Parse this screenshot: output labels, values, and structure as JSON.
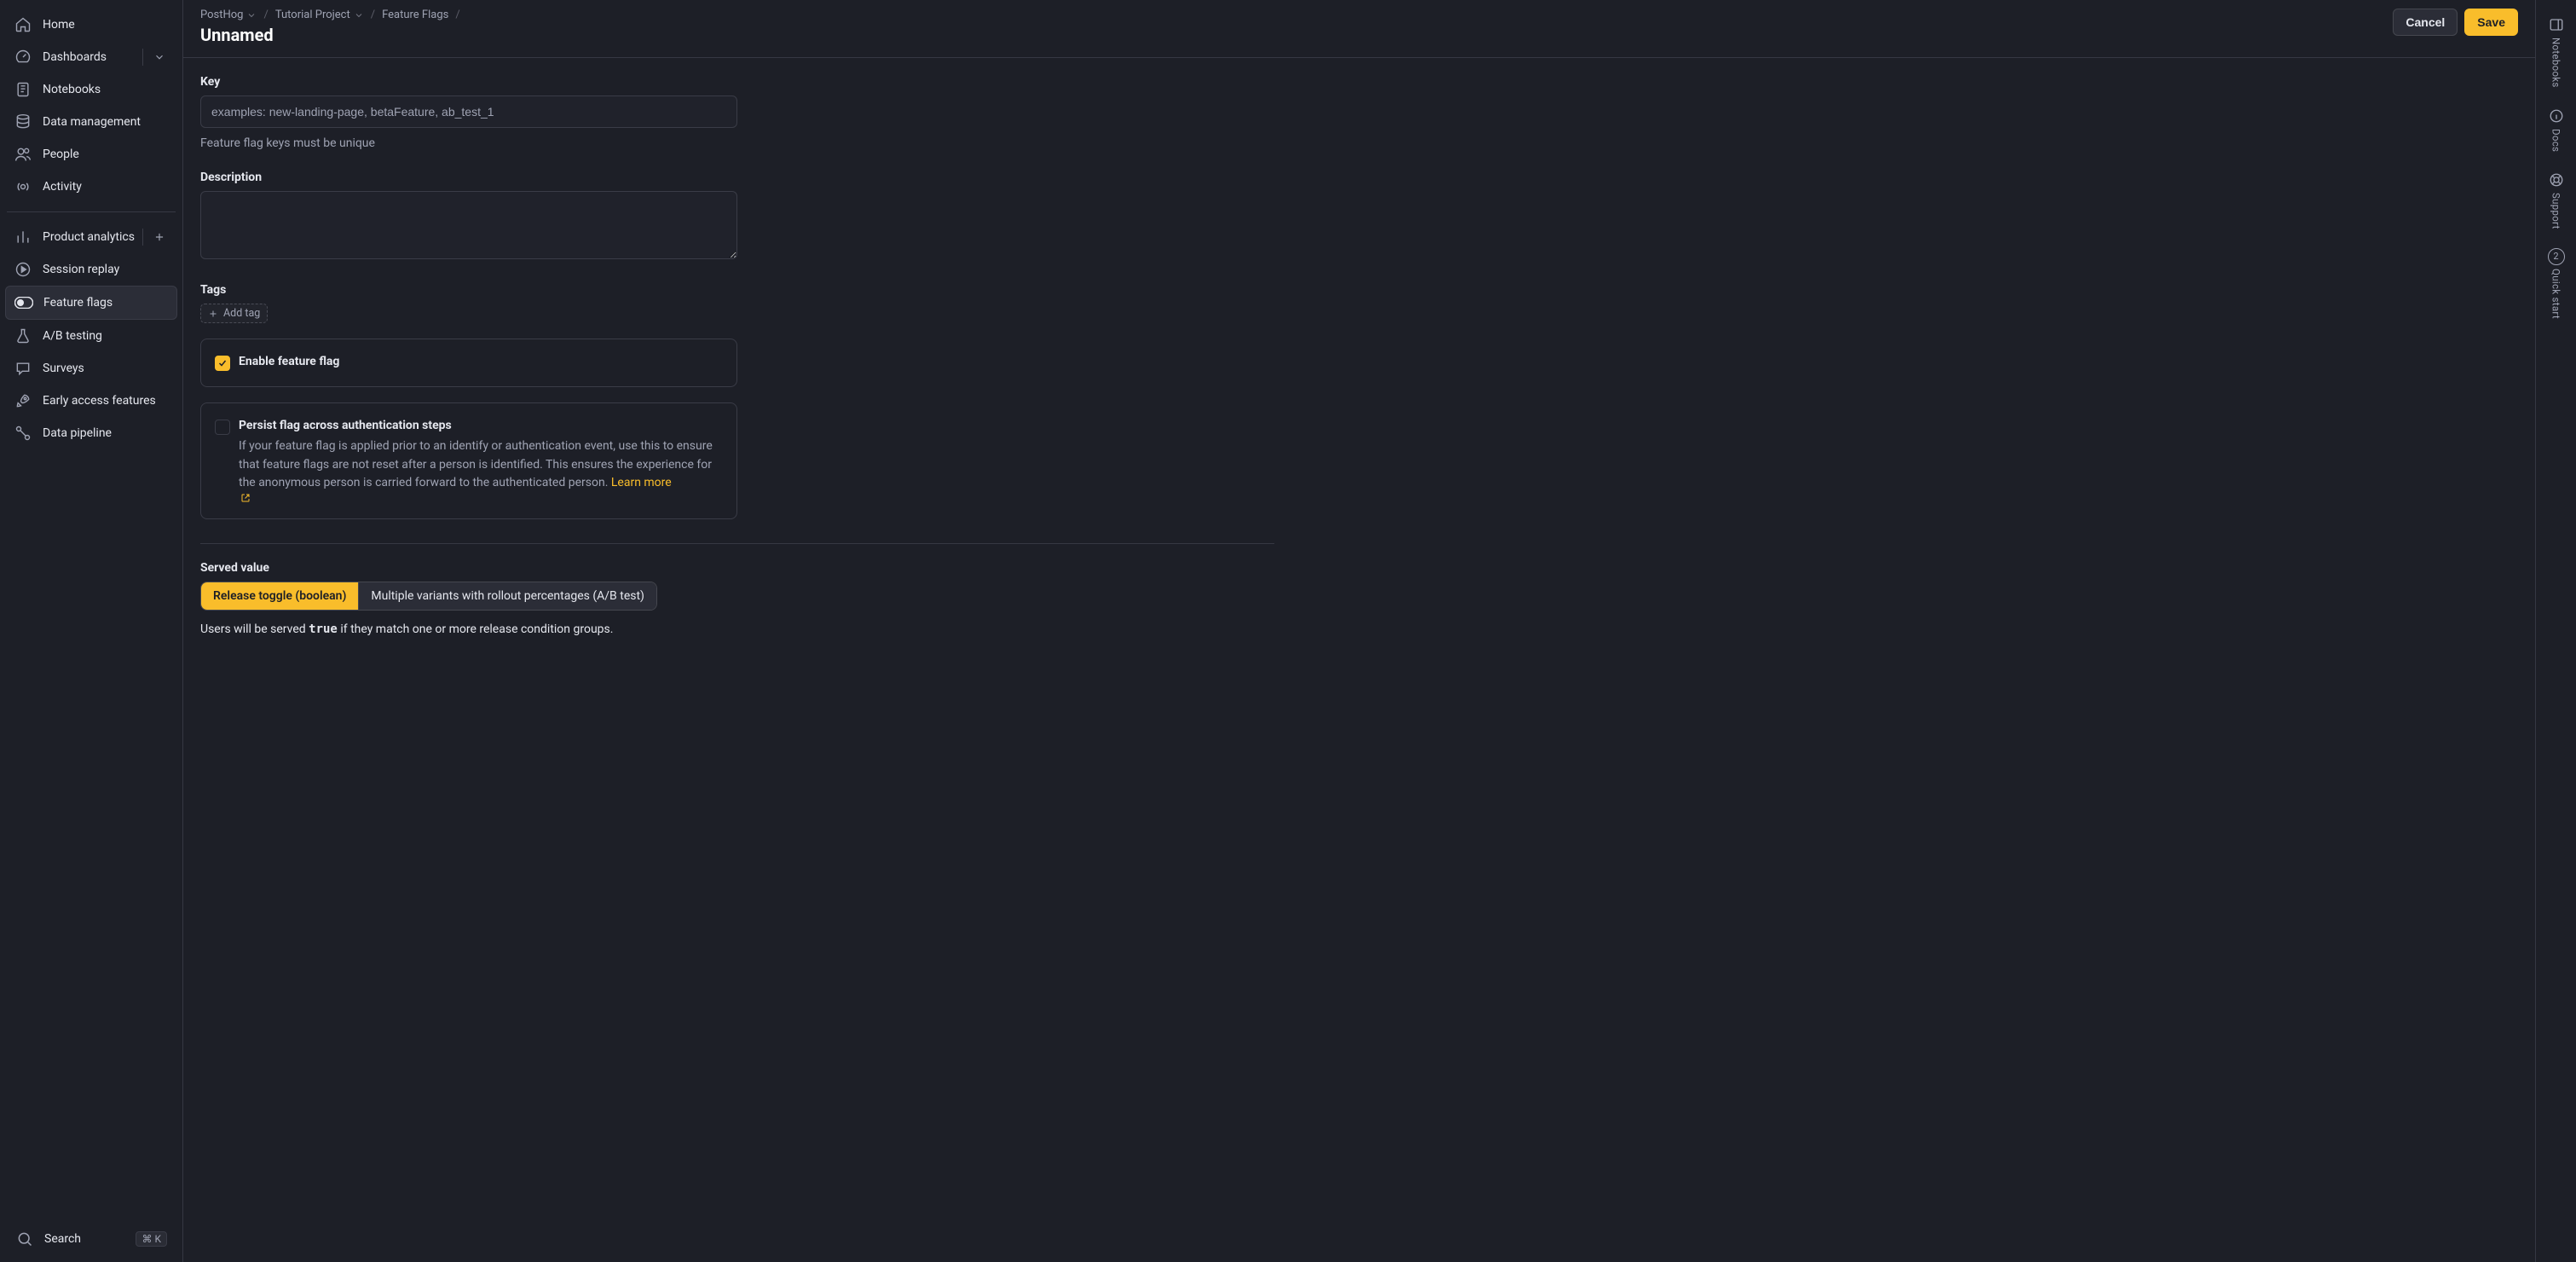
{
  "sidebar": {
    "items": [
      {
        "label": "Home"
      },
      {
        "label": "Dashboards"
      },
      {
        "label": "Notebooks"
      },
      {
        "label": "Data management"
      },
      {
        "label": "People"
      },
      {
        "label": "Activity"
      },
      {
        "label": "Product analytics"
      },
      {
        "label": "Session replay"
      },
      {
        "label": "Feature flags"
      },
      {
        "label": "A/B testing"
      },
      {
        "label": "Surveys"
      },
      {
        "label": "Early access features"
      },
      {
        "label": "Data pipeline"
      }
    ],
    "search_label": "Search",
    "search_kbd": "⌘ K"
  },
  "breadcrumbs": {
    "items": [
      {
        "label": "PostHog",
        "has_menu": true
      },
      {
        "label": "Tutorial Project",
        "has_menu": true
      },
      {
        "label": "Feature Flags",
        "has_menu": false
      }
    ]
  },
  "page_title": "Unnamed",
  "actions": {
    "cancel": "Cancel",
    "save": "Save"
  },
  "form": {
    "key_label": "Key",
    "key_placeholder": "examples: new-landing-page, betaFeature, ab_test_1",
    "key_help": "Feature flag keys must be unique",
    "desc_label": "Description",
    "tags_label": "Tags",
    "add_tag_label": "Add tag",
    "enable_label": "Enable feature flag",
    "enable_checked": true,
    "persist_label": "Persist flag across authentication steps",
    "persist_checked": false,
    "persist_help": "If your feature flag is applied prior to an identify or authentication event, use this to ensure that feature flags are not reset after a person is identified. This ensures the experience for the anonymous person is carried forward to the authenticated person.",
    "learn_more": "Learn more",
    "served_label": "Served value",
    "served_options": [
      "Release toggle (boolean)",
      "Multiple variants with rollout percentages (A/B test)"
    ],
    "served_help_pre": "Users will be served ",
    "served_help_code": "true",
    "served_help_post": " if they match one or more release condition groups."
  },
  "rail": {
    "notebooks": "Notebooks",
    "docs": "Docs",
    "support": "Support",
    "quick_start": "Quick start",
    "quick_start_count": "2"
  }
}
